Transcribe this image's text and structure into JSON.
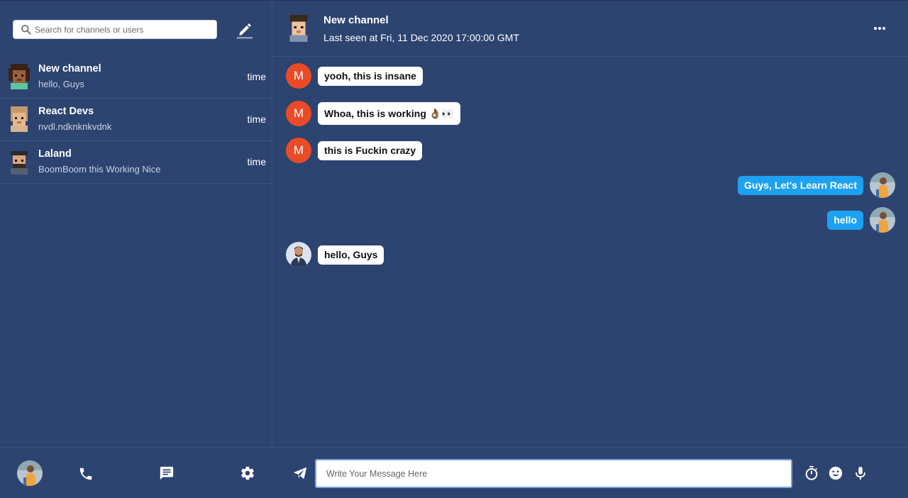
{
  "search": {
    "placeholder": "Search for channels or users"
  },
  "sidebar": {
    "conversations": [
      {
        "name": "New channel",
        "preview": "hello, Guys",
        "time": "time"
      },
      {
        "name": "React Devs",
        "preview": "nvdl.ndknknkvdnk",
        "time": "time"
      },
      {
        "name": "Laland",
        "preview": "BoomBoom this Working Nice",
        "time": "time"
      }
    ]
  },
  "chat": {
    "title": "New channel",
    "status": "Last seen at Fri, 11 Dec 2020 17:00:00 GMT",
    "messages": [
      {
        "sender_initial": "M",
        "text": "yooh, this is insane",
        "mine": false
      },
      {
        "sender_initial": "M",
        "text": "Whoa, this is working 👌🏾👀",
        "mine": false
      },
      {
        "sender_initial": "M",
        "text": "this is Fuckin crazy",
        "mine": false
      },
      {
        "text": "Guys, Let's Learn React",
        "mine": true
      },
      {
        "text": "hello",
        "mine": true
      },
      {
        "text": "hello, Guys",
        "mine": false
      }
    ]
  },
  "composer": {
    "placeholder": "Write Your Message Here"
  },
  "colors": {
    "background": "#2d4471",
    "accent": "#1ea1f1",
    "avatar_red": "#ea4b26",
    "bubble": "#ffffff"
  },
  "icons": [
    "search-icon",
    "pencil-icon",
    "phone-icon",
    "chat-icon",
    "gear-icon",
    "send-icon",
    "timer-icon",
    "emoji-icon",
    "mic-icon",
    "more-icon"
  ]
}
